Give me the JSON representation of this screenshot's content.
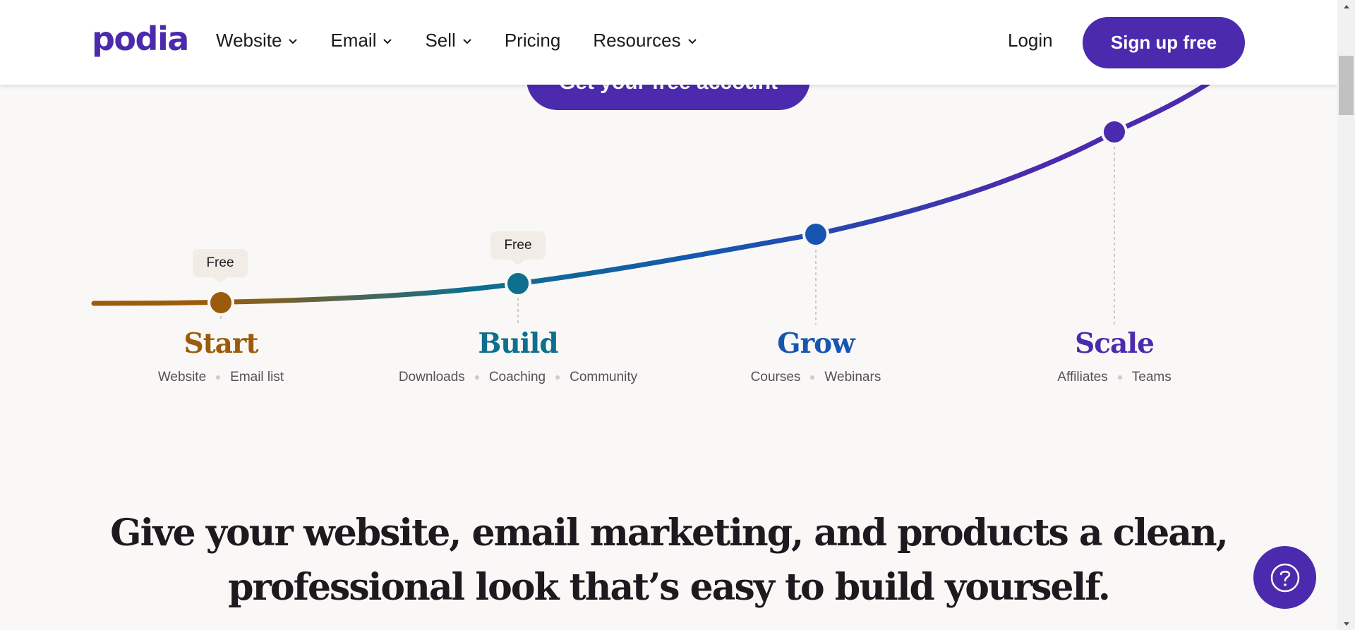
{
  "header": {
    "logo": "podia",
    "nav": [
      {
        "label": "Website",
        "has_dropdown": true
      },
      {
        "label": "Email",
        "has_dropdown": true
      },
      {
        "label": "Sell",
        "has_dropdown": true
      },
      {
        "label": "Pricing",
        "has_dropdown": false
      },
      {
        "label": "Resources",
        "has_dropdown": true
      }
    ],
    "login_label": "Login",
    "signup_label": "Sign up free"
  },
  "cta_label": "Get your free account",
  "stages": [
    {
      "title": "Start",
      "items": [
        "Website",
        "Email list"
      ],
      "tag": "Free",
      "color": "#9a5c0c"
    },
    {
      "title": "Build",
      "items": [
        "Downloads",
        "Coaching",
        "Community"
      ],
      "tag": "Free",
      "color": "#0e6f8e"
    },
    {
      "title": "Grow",
      "items": [
        "Courses",
        "Webinars"
      ],
      "tag": "",
      "color": "#1656b0"
    },
    {
      "title": "Scale",
      "items": [
        "Affiliates",
        "Teams"
      ],
      "tag": "",
      "color": "#4b2aad"
    }
  ],
  "headline": {
    "line1": "Give your website, email marketing, and products a clean,",
    "line2": "professional look that’s easy to build yourself."
  },
  "help_icon": "question-icon",
  "colors": {
    "brand": "#4b2aad",
    "background": "#faf8f6"
  }
}
